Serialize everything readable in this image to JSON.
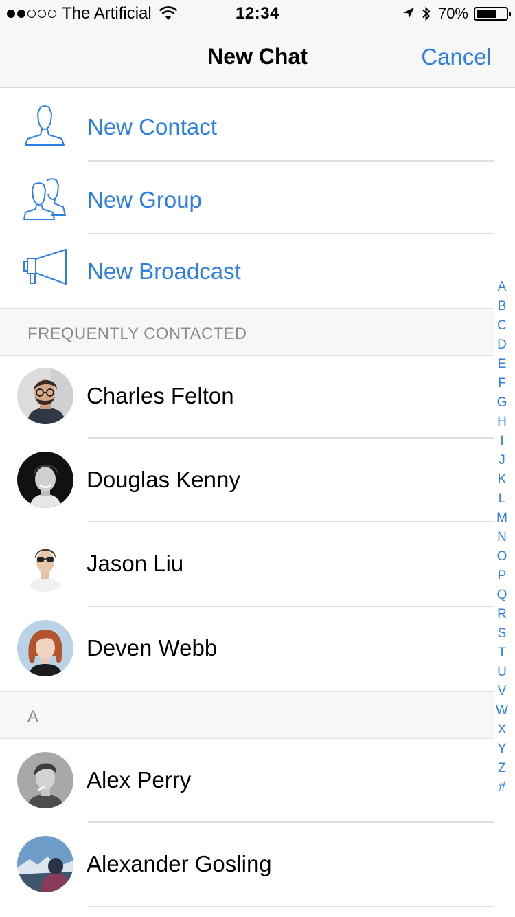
{
  "status_bar": {
    "carrier": "The Artificial",
    "time": "12:34",
    "battery": "70%",
    "battery_level": 0.7,
    "signal_bars_filled": 2,
    "signal_bars_total": 5
  },
  "nav": {
    "title": "New Chat",
    "cancel_label": "Cancel"
  },
  "actions": [
    {
      "label": "New Contact",
      "icon": "person-icon"
    },
    {
      "label": "New Group",
      "icon": "group-icon"
    },
    {
      "label": "New Broadcast",
      "icon": "megaphone-icon"
    }
  ],
  "sections": [
    {
      "header": "FREQUENTLY CONTACTED",
      "contacts": [
        "Charles Felton",
        "Douglas Kenny",
        "Jason Liu",
        "Deven Webb"
      ]
    },
    {
      "header": "A",
      "contacts": [
        "Alex Perry",
        "Alexander Gosling"
      ]
    }
  ],
  "index_letters": [
    "A",
    "B",
    "C",
    "D",
    "E",
    "F",
    "G",
    "H",
    "I",
    "J",
    "K",
    "L",
    "M",
    "N",
    "O",
    "P",
    "Q",
    "R",
    "S",
    "T",
    "U",
    "V",
    "W",
    "X",
    "Y",
    "Z",
    "#"
  ],
  "colors": {
    "accent": "#2d7fe6",
    "section_bg": "#f7f7f7",
    "section_text": "#8a8a8a",
    "separator": "#e0e0e0"
  }
}
